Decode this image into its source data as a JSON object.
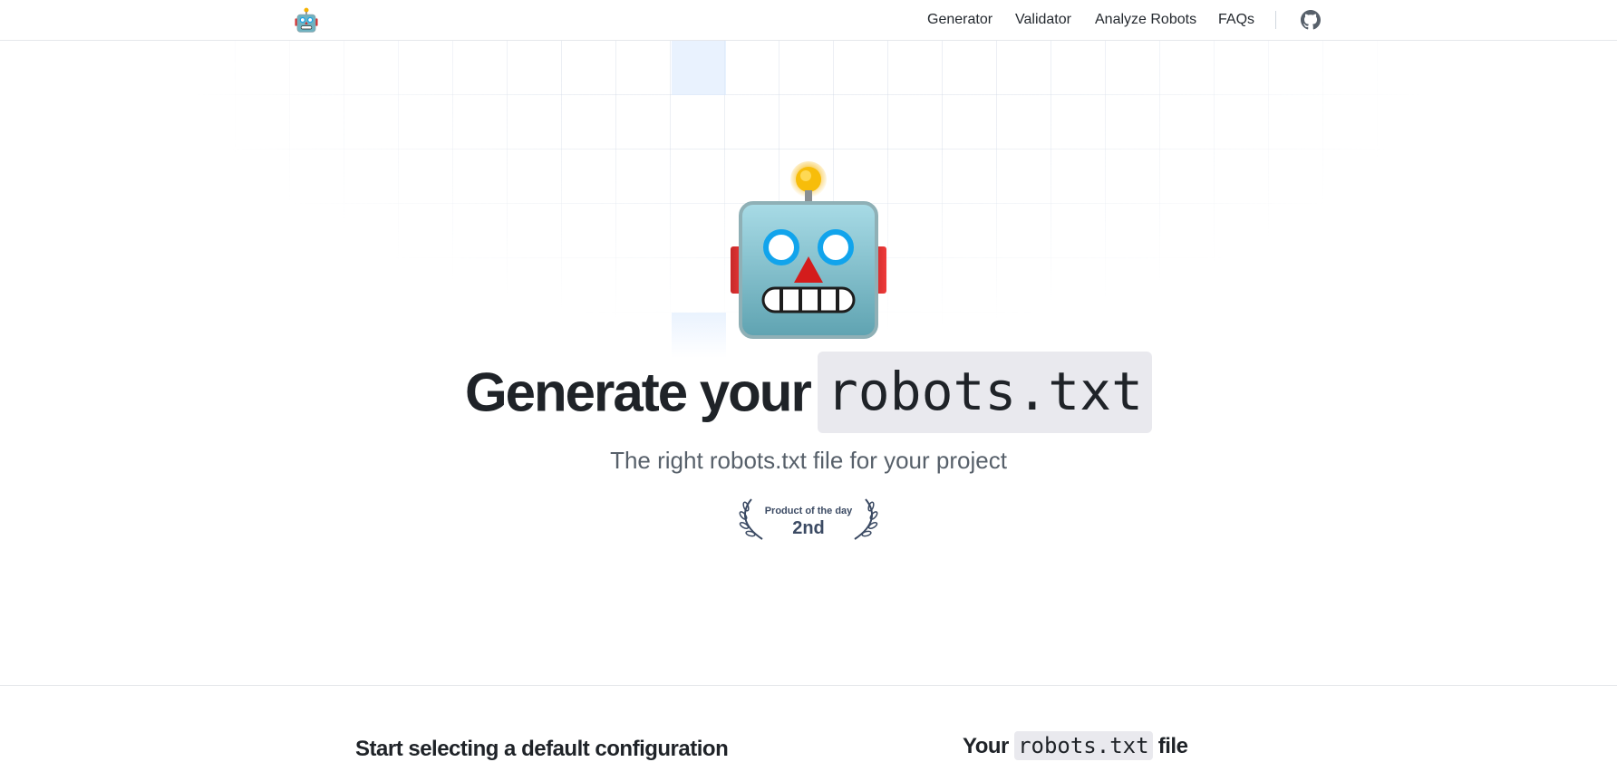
{
  "nav": {
    "items": [
      {
        "label": "Generator"
      },
      {
        "label": "Validator"
      },
      {
        "label": "Analyze Robots"
      },
      {
        "label": "FAQs"
      }
    ],
    "logo_icon": "robot-emoji",
    "github_icon": "github-icon"
  },
  "hero": {
    "title_text": "Generate your",
    "title_code": "robots.txt",
    "subtitle": "The right robots.txt file for your project",
    "robot_icon": "robot-face"
  },
  "badge": {
    "title": "Product of the day",
    "rank": "2nd"
  },
  "sections": {
    "left_heading": "Start selecting a default configuration",
    "right_heading_prefix": "Your",
    "right_heading_code": "robots.txt",
    "right_heading_suffix": "file"
  },
  "colors": {
    "accent_blue": "#dbeafe",
    "badge_text": "#3b4a63",
    "code_bg": "#e9e9ee"
  }
}
